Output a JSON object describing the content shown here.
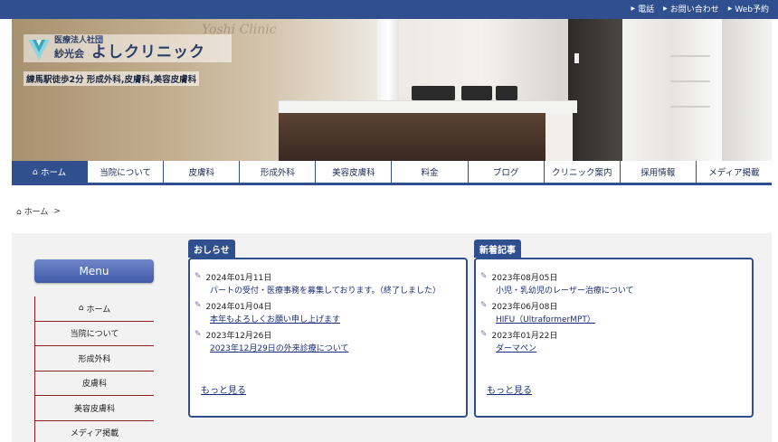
{
  "topbar": {
    "links": [
      {
        "label": "電話"
      },
      {
        "label": "お問い合わせ"
      },
      {
        "label": "Web予約"
      }
    ]
  },
  "header": {
    "watermark": "Yoshi Clinic",
    "corp": "医療法人社団",
    "org": "紗光会",
    "name": "よしクリニック",
    "tagline": "練馬駅徒歩2分 形成外科,皮膚科,美容皮膚科"
  },
  "nav": {
    "items": [
      {
        "label": "ホーム"
      },
      {
        "label": "当院について"
      },
      {
        "label": "皮膚科"
      },
      {
        "label": "形成外科"
      },
      {
        "label": "美容皮膚科"
      },
      {
        "label": "料金"
      },
      {
        "label": "ブログ"
      },
      {
        "label": "クリニック案内"
      },
      {
        "label": "採用情報"
      },
      {
        "label": "メディア掲載"
      }
    ]
  },
  "breadcrumb": {
    "home": "ホーム",
    "separator": ">"
  },
  "sidebar": {
    "title": "Menu",
    "items": [
      {
        "label": "ホーム"
      },
      {
        "label": "当院について"
      },
      {
        "label": "形成外科"
      },
      {
        "label": "皮膚科"
      },
      {
        "label": "美容皮膚科"
      },
      {
        "label": "メディア掲載"
      }
    ]
  },
  "news": {
    "title": "おしらせ",
    "entries": [
      {
        "date": "2024年01月11日",
        "title": "パートの受付・医療事務を募集しております。（終了しました）"
      },
      {
        "date": "2024年01月04日",
        "title": "本年もよろしくお願い申し上げます"
      },
      {
        "date": "2023年12月26日",
        "title": "2023年12月29日の外来診療について"
      }
    ],
    "more": "もっと見る"
  },
  "articles": {
    "title": "新着記事",
    "entries": [
      {
        "date": "2023年08月05日",
        "title": "小児・乳幼児のレーザー治療について"
      },
      {
        "date": "2023年06月08日",
        "title": "HIFU（UltraformerMPT）"
      },
      {
        "date": "2023年01月22日",
        "title": "ダーマペン"
      }
    ],
    "more": "もっと見る"
  },
  "colors": {
    "brand": "#2f4f8f",
    "menu_border": "#8c1e1e",
    "link": "#1a2d7a"
  },
  "icons": {
    "home": "home-icon",
    "pencil": "pencil-icon",
    "arrow": "triangle-right-icon"
  }
}
